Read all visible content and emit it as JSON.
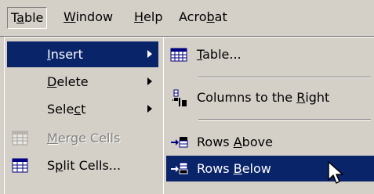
{
  "menubar": {
    "items": [
      {
        "pre": "T",
        "key": "a",
        "post": "ble"
      },
      {
        "pre": "",
        "key": "W",
        "post": "indow"
      },
      {
        "pre": "",
        "key": "H",
        "post": "elp"
      },
      {
        "pre": "Acro",
        "key": "b",
        "post": "at"
      }
    ],
    "open_menu": "Table"
  },
  "table_menu": {
    "items": [
      {
        "pre": "",
        "key": "I",
        "post": "nsert",
        "submenu": true,
        "highlighted": true
      },
      {
        "pre": "",
        "key": "D",
        "post": "elete",
        "submenu": true
      },
      {
        "pre": "Sele",
        "key": "c",
        "post": "t",
        "submenu": true
      },
      {
        "pre": "",
        "key": "M",
        "post": "erge Cells",
        "disabled": true,
        "icon": "merge-cells-icon"
      },
      {
        "pre": "S",
        "key": "p",
        "post": "lit Cells...",
        "icon": "split-cells-icon"
      }
    ]
  },
  "insert_submenu": {
    "items": [
      {
        "pre": "",
        "key": "T",
        "post": "able...",
        "icon": "insert-table-icon"
      },
      {
        "pre": "Columns to the ",
        "key": "R",
        "post": "ight",
        "icon": "insert-column-right-icon"
      },
      {
        "pre": "Rows ",
        "key": "A",
        "post": "bove",
        "icon": "insert-row-above-icon"
      },
      {
        "pre": "Rows ",
        "key": "B",
        "post": "elow",
        "icon": "insert-row-below-icon",
        "highlighted": true
      }
    ]
  },
  "colors": {
    "highlight": "#0a246a",
    "menu_face": "#d4d0c8",
    "disabled_text": "#808080"
  }
}
